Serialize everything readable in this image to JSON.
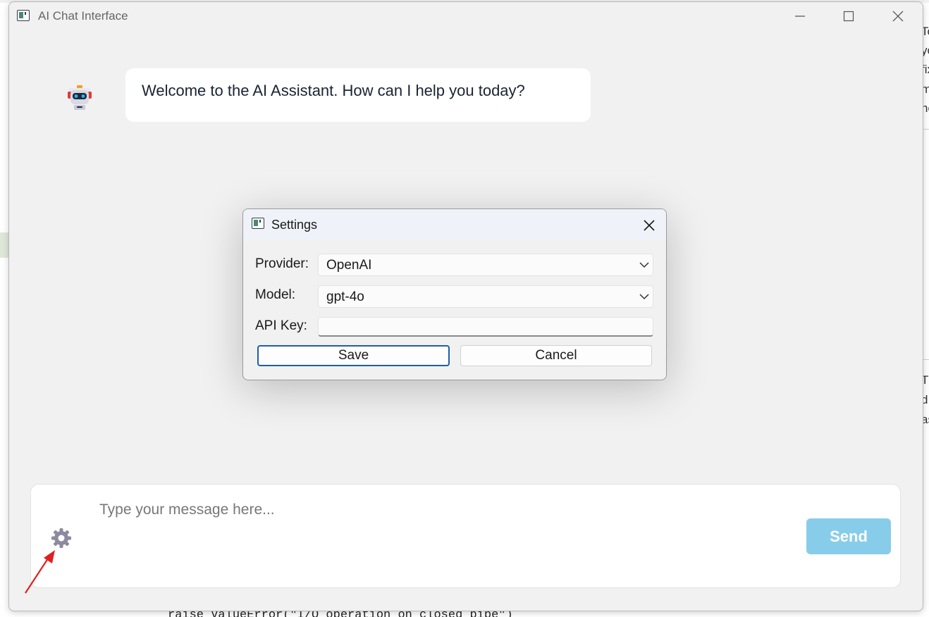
{
  "window": {
    "title": "AI Chat Interface",
    "icons": {
      "app": "app-window-icon",
      "minimize": "minimize-icon",
      "maximize": "maximize-icon",
      "close": "close-icon"
    }
  },
  "chat": {
    "messages": [
      {
        "sender": "assistant",
        "avatar": "robot-icon",
        "text": "Welcome to the AI Assistant. How can I help you today?"
      }
    ]
  },
  "composer": {
    "placeholder": "Type your message here...",
    "value": "",
    "send_label": "Send",
    "settings_icon": "gear-icon",
    "send_color": "#87cdea"
  },
  "settings_dialog": {
    "title": "Settings",
    "provider": {
      "label": "Provider:",
      "value": "OpenAI"
    },
    "model": {
      "label": "Model:",
      "value": "gpt-4o"
    },
    "api_key": {
      "label": "API Key:",
      "value": ""
    },
    "save_label": "Save",
    "cancel_label": "Cancel",
    "accent": "#1e5fa8"
  },
  "background": {
    "right_panel_fragments": [
      "To",
      "yo",
      "fix",
      "m",
      "ne",
      "Th",
      "d",
      "as"
    ],
    "code_line": "raise ValueError(\"I/O operation on closed pipe\")"
  },
  "annotation": {
    "color": "#e02020",
    "points_to": "gear-icon"
  }
}
